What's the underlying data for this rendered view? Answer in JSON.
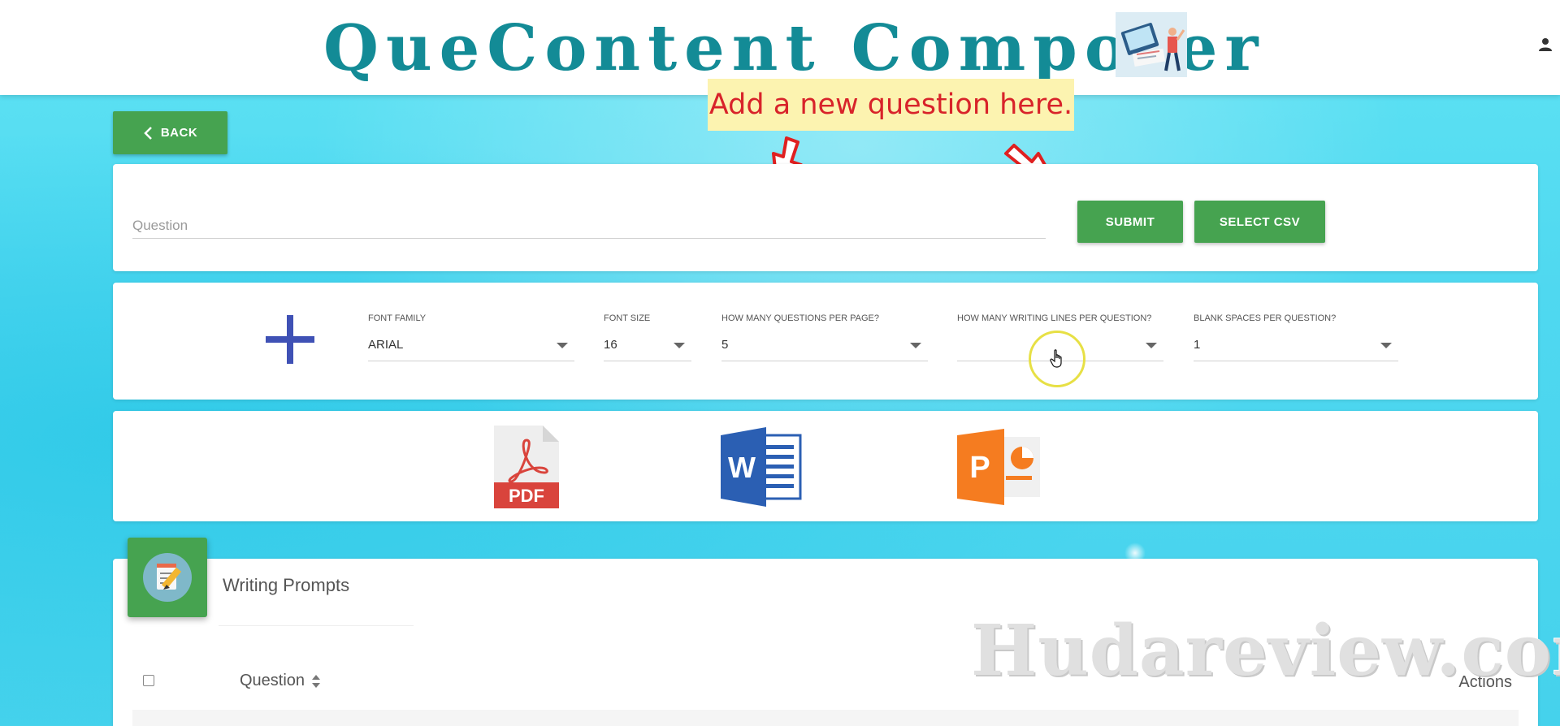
{
  "header": {
    "title": "QueContent Composer",
    "logo_icon": "writing-laptop-illustration-icon",
    "user_icon": "person-icon"
  },
  "annotation": {
    "text": "Add a new question here.",
    "text_color": "#d8232a",
    "background": "#fcf3b0"
  },
  "nav": {
    "back_label": "BACK",
    "back_icon": "chevron-left-icon"
  },
  "question_form": {
    "input_placeholder": "Question",
    "input_value": "",
    "submit_label": "SUBMIT",
    "select_csv_label": "SELECT CSV"
  },
  "settings": {
    "add_icon": "plus-icon",
    "fields": [
      {
        "label": "FONT FAMILY",
        "value": "ARIAL"
      },
      {
        "label": "FONT SIZE",
        "value": "16"
      },
      {
        "label": "HOW MANY QUESTIONS PER PAGE?",
        "value": "5"
      },
      {
        "label": "HOW MANY WRITING LINES PER QUESTION?",
        "value": ""
      },
      {
        "label": "BLANK SPACES PER QUESTION?",
        "value": "1"
      }
    ]
  },
  "exports": {
    "pdf_label": "PDF",
    "word_label": "W",
    "ppt_label": "P",
    "icons": [
      "pdf-icon",
      "word-icon",
      "powerpoint-icon"
    ]
  },
  "prompts": {
    "badge_icon": "notepad-pencil-icon",
    "title": "Writing Prompts",
    "columns": {
      "question": "Question",
      "actions": "Actions"
    },
    "sort_icon": "sort-icon"
  },
  "watermark": {
    "text": "Hudareview.com"
  },
  "colors": {
    "brand": "#138b96",
    "button_green": "#46a350",
    "accent_blue": "#3f51b5",
    "background": "#4fd8f0"
  }
}
